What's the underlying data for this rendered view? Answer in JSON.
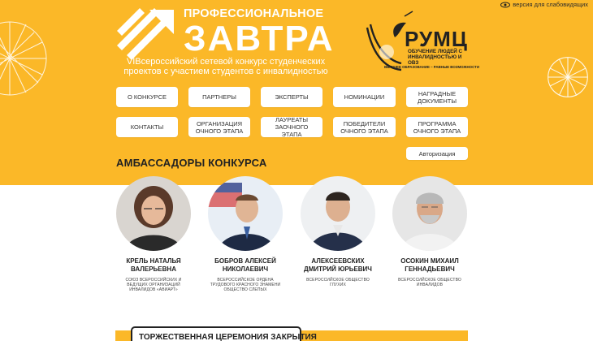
{
  "header": {
    "accessibility_label": "версия для слабовидящих",
    "title_top": "ПРОФЕССИОНАЛЬНОЕ",
    "title_big": "ЗАВТРА",
    "subtitle": "VIВсероссийский сетевой конкурс студенческих проектов  с участием студентов с инвалидностью"
  },
  "partner": {
    "name": "РУМЦ",
    "line1": "ОБУЧЕНИЕ ЛЮДЕЙ С ИНВАЛИДНОСТЬЮ И ОВЗ",
    "line2": "ВЫСШЕЕ ОБРАЗОВАНИЕ – РАВНЫЕ ВОЗМОЖНОСТИ"
  },
  "nav": {
    "about": "О КОНКУРСЕ",
    "partners": "ПАРТНЕРЫ",
    "experts": "ЭКСПЕРТЫ",
    "nominations": "НОМИНАЦИИ",
    "award_docs": "НАГРАДНЫЕ ДОКУМЕНТЫ",
    "contacts": "КОНТАКТЫ",
    "organization": "ОРГАНИЗАЦИЯ ОЧНОГО ЭТАПА",
    "laureates": "ЛАУРЕАТЫ ЗАОЧНОГО ЭТАПА",
    "winners": "ПОБЕДИТЕЛИ ОЧНОГО ЭТАПА",
    "program": "ПРОГРАММА ОЧНОГО ЭТАПА",
    "auth": "Авторизация"
  },
  "ambassadors": {
    "title": "АМБАССАДОРЫ КОНКУРСА",
    "items": [
      {
        "name": "КРЕЛЬ НАТАЛЬЯ ВАЛЕРЬЕВНА",
        "desc": "СОЮЗ ВСЕРОССИЙСКИХ И ВЕДУЩИХ ОРГАНИЗАЦИЙ ИНВАЛИДОВ «АВИАРТ»"
      },
      {
        "name": "БОБРОВ АЛЕКСЕЙ НИКОЛАЕВИЧ",
        "desc": "ВСЕРОССИЙСКОЕ ОРДЕНА ТРУДОВОГО КРАСНОГО ЗНАМЕНИ ОБЩЕСТВО СЛЕПЫХ"
      },
      {
        "name": "АЛЕКСЕЕВСКИХ ДМИТРИЙ ЮРЬЕВИЧ",
        "desc": "ВСЕРОССИЙСКОЕ ОБЩЕСТВО ГЛУХИХ"
      },
      {
        "name": "ОСОКИН МИХАИЛ ГЕННАДЬЕВИЧ",
        "desc": "ВСЕРОССИЙСКОЕ ОБЩЕСТВО ИНВАЛИДОВ"
      }
    ]
  },
  "closing": {
    "label": "ТОРЖЕСТВЕННАЯ ЦЕРЕМОНИЯ ЗАКРЫТИЯ"
  },
  "colors": {
    "accent": "#fbb828",
    "text": "#222222"
  }
}
